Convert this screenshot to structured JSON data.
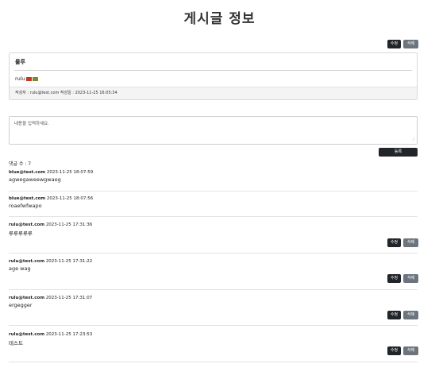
{
  "page_title": "게시글 정보",
  "post": {
    "edit_label": "수정",
    "delete_label": "삭제",
    "title": "룰루",
    "body": "rulu",
    "meta": "작성자 : rulu@test.com 작성일 : 2023-11-25 16:05:34"
  },
  "comment_form": {
    "placeholder": "내용을 입력하세요.",
    "submit_label": "등록"
  },
  "comment_count": "댓글 수 : 7",
  "comments": [
    {
      "author": "blue@test.com",
      "time": "2023-11-25 18:07:59",
      "text": "agwegaweewgwaeg",
      "edit_label": "",
      "delete_label": ""
    },
    {
      "author": "blue@test.com",
      "time": "2023-11-25 18:07:56",
      "text": "roaefwfwapo",
      "edit_label": "",
      "delete_label": ""
    },
    {
      "author": "rulu@test.com",
      "time": "2023-11-25 17:31:36",
      "text": "루루루루루",
      "edit_label": "수정",
      "delete_label": "삭제"
    },
    {
      "author": "rulu@test.com",
      "time": "2023-11-25 17:31:22",
      "text": "age wag",
      "edit_label": "수정",
      "delete_label": "삭제"
    },
    {
      "author": "rulu@test.com",
      "time": "2023-11-25 17:31:07",
      "text": "ergegger",
      "edit_label": "수정",
      "delete_label": "삭제"
    },
    {
      "author": "rulu@test.com",
      "time": "2023-11-25 17:23:53",
      "text": "테스트",
      "edit_label": "수정",
      "delete_label": "삭제"
    }
  ]
}
